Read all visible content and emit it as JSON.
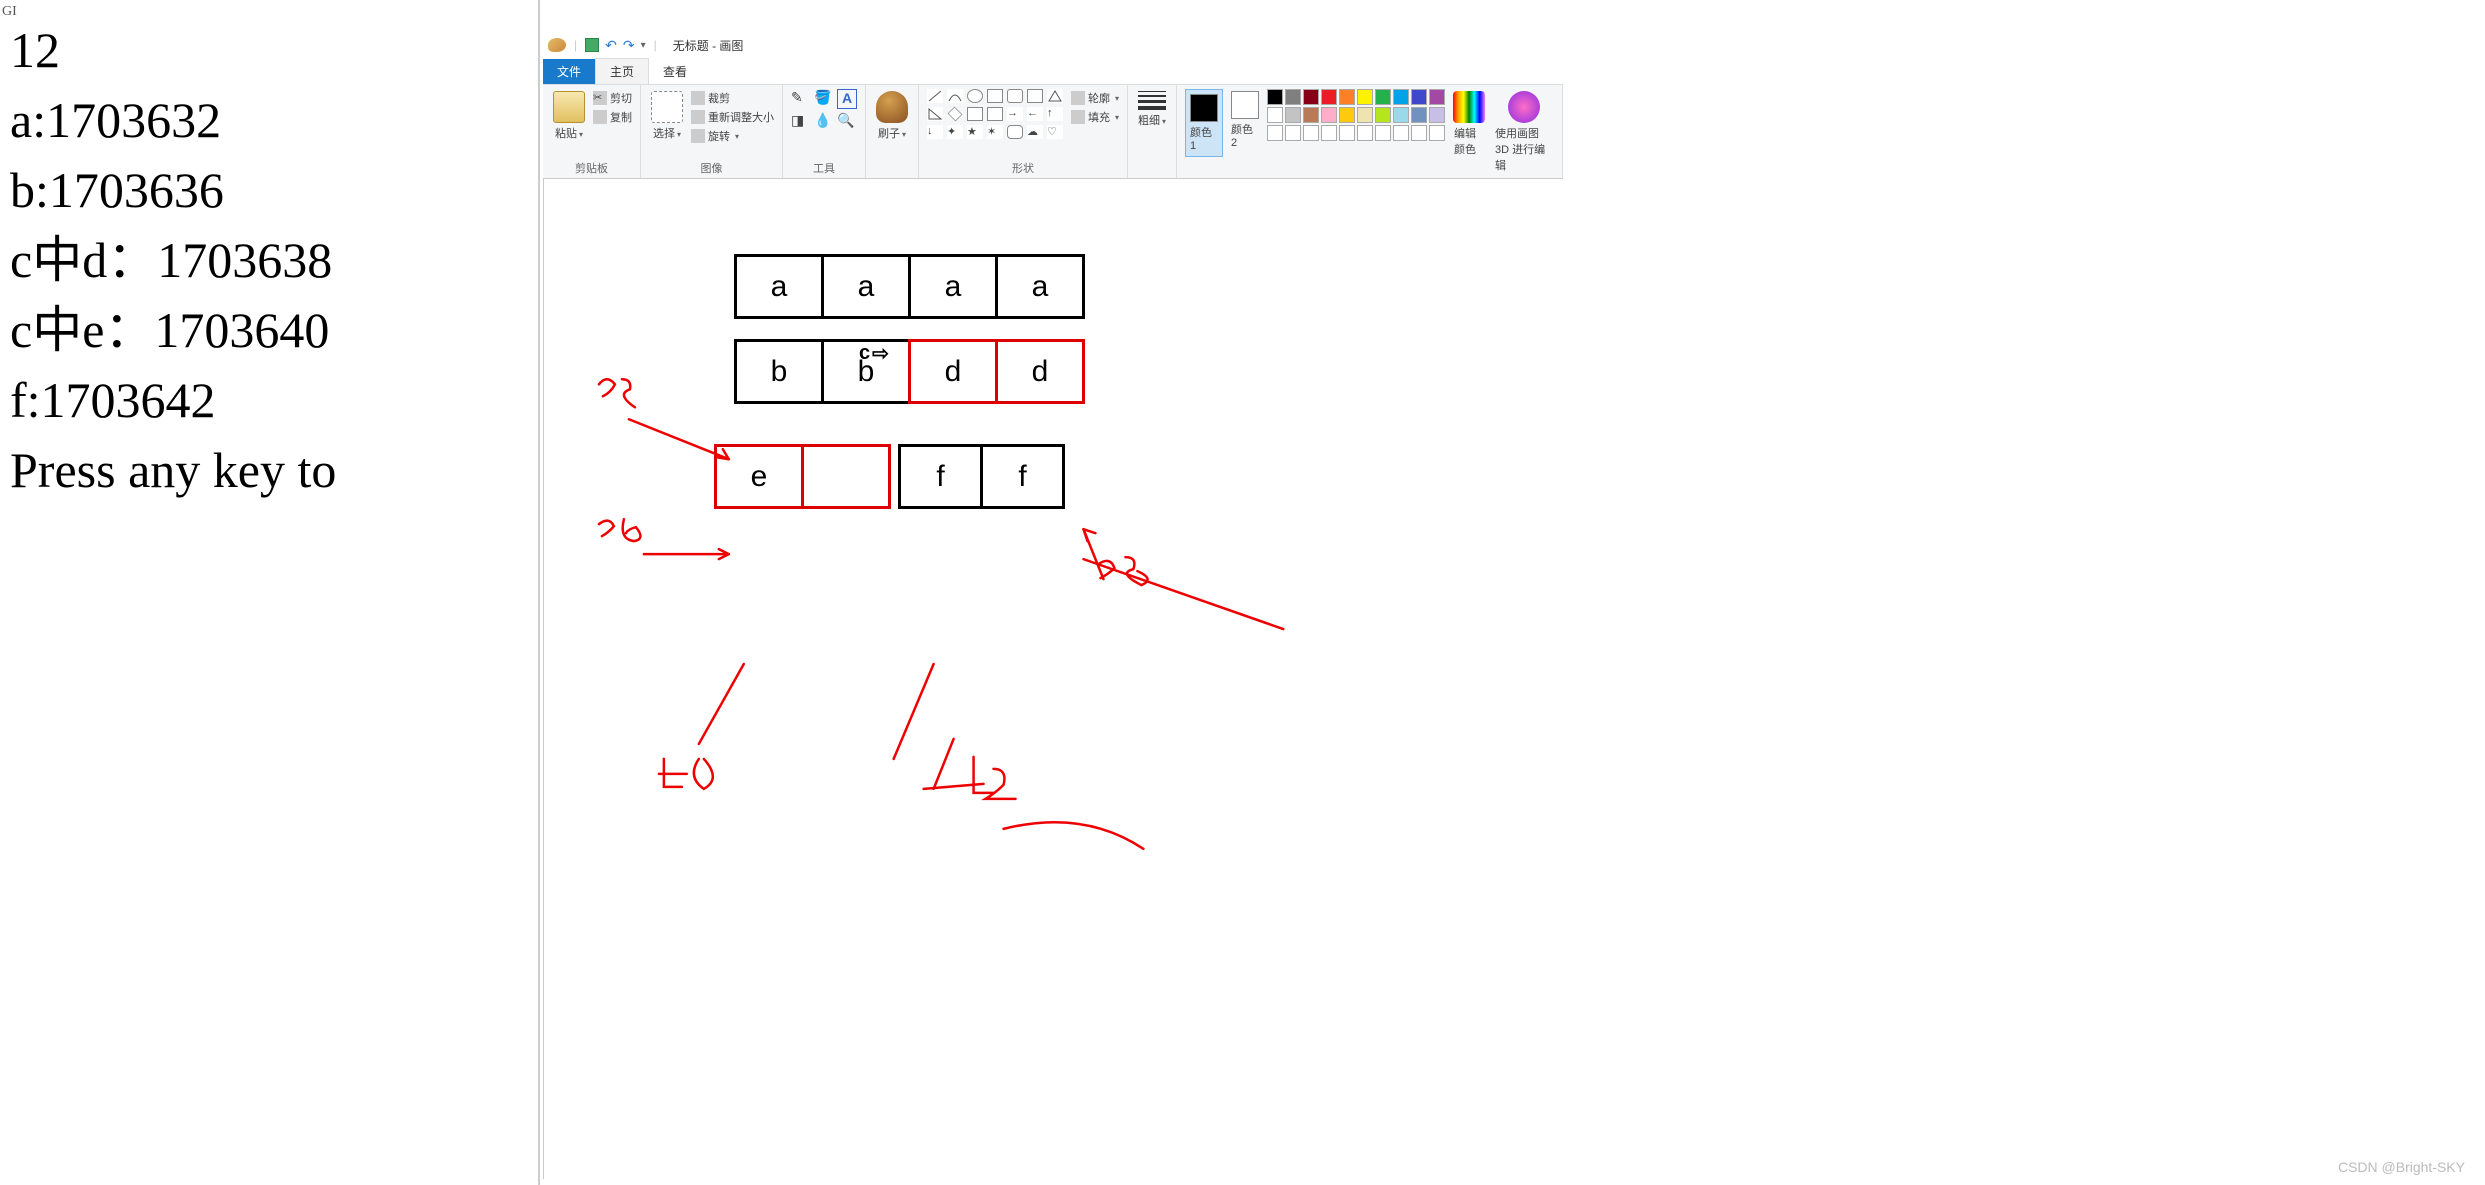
{
  "console": {
    "gi_marker": "GI",
    "lines": [
      "12",
      "a:1703632",
      "b:1703636",
      "c中d：1703638",
      "c中e：1703640",
      "f:1703642",
      "Press any key to"
    ]
  },
  "paint": {
    "window_title": "无标题 - 画图",
    "tabs": {
      "file": "文件",
      "home": "主页",
      "view": "查看"
    },
    "groups": {
      "clipboard": {
        "label": "剪贴板",
        "paste": "粘贴",
        "cut": "剪切",
        "copy": "复制"
      },
      "image": {
        "label": "图像",
        "select": "选择",
        "crop": "裁剪",
        "resize": "重新调整大小",
        "rotate": "旋转"
      },
      "tools": {
        "label": "工具"
      },
      "brushes": {
        "label": "刷子",
        "brush": "刷子"
      },
      "shapes": {
        "label": "形状",
        "outline": "轮廓",
        "fill": "填充"
      },
      "lineweight": {
        "label": "粗细",
        "btn": "粗细"
      },
      "colors": {
        "label": "颜色",
        "color1": "颜色 1",
        "color2": "颜色 2",
        "edit": "编辑颜色",
        "paint3d": "使用画图 3D 进行编辑"
      }
    },
    "color_palette": [
      "#000000",
      "#7f7f7f",
      "#880015",
      "#ed1c24",
      "#ff7f27",
      "#fff200",
      "#22b14c",
      "#00a2e8",
      "#3f48cc",
      "#a349a4",
      "#ffffff",
      "#c3c3c3",
      "#b97a57",
      "#ffaec9",
      "#ffc90e",
      "#efe4b0",
      "#b5e61d",
      "#99d9ea",
      "#7092be",
      "#c8bfe7",
      "#ffffff",
      "#ffffff",
      "#ffffff",
      "#ffffff",
      "#ffffff",
      "#ffffff",
      "#ffffff",
      "#ffffff",
      "#ffffff",
      "#ffffff"
    ],
    "color1": "#000000",
    "color2": "#ffffff"
  },
  "diagram": {
    "row1": [
      "a",
      "a",
      "a",
      "a"
    ],
    "row2_left": [
      "b",
      "b"
    ],
    "row2_right": [
      "d",
      "d"
    ],
    "row3_left": [
      "e",
      ""
    ],
    "row3_right": [
      "f",
      "f"
    ],
    "c_label": "c",
    "handwritten": {
      "n32": "32",
      "n36": "36",
      "n38": "38",
      "n40": "40",
      "n42": "42"
    }
  },
  "watermark": "CSDN @Bright-SKY"
}
